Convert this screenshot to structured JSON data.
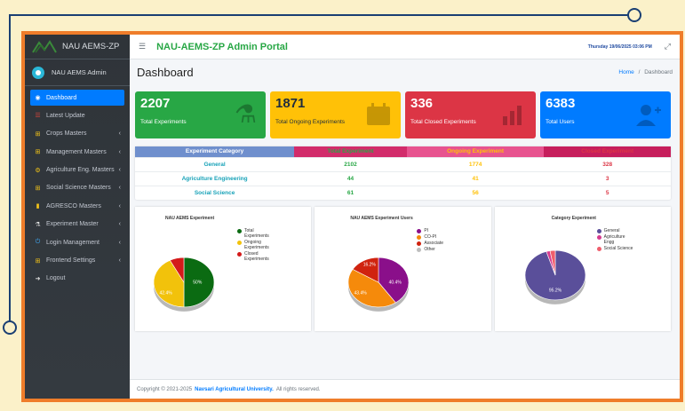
{
  "sidebar": {
    "brand": "NAU AEMS-ZP",
    "user_name": "NAU AEMS Admin",
    "items": [
      {
        "label": "Dashboard",
        "icon": "dashboard-icon",
        "chevron": false,
        "active": true
      },
      {
        "label": "Latest Update",
        "icon": "list-icon",
        "chevron": false,
        "active": false
      },
      {
        "label": "Crops Masters",
        "icon": "plus-square-icon",
        "chevron": true,
        "active": false
      },
      {
        "label": "Management Masters",
        "icon": "plus-square-icon",
        "chevron": true,
        "active": false
      },
      {
        "label": "Agriculture Eng. Masters",
        "icon": "cogs-icon",
        "chevron": true,
        "active": false
      },
      {
        "label": "Social Science Masters",
        "icon": "plus-square-icon",
        "chevron": true,
        "active": false
      },
      {
        "label": "AGRESCO Masters",
        "icon": "clipboard-icon",
        "chevron": true,
        "active": false
      },
      {
        "label": "Experiment Master",
        "icon": "flask-icon",
        "chevron": true,
        "active": false
      },
      {
        "label": "Login Management",
        "icon": "power-icon",
        "chevron": true,
        "active": false
      },
      {
        "label": "Frontend Settings",
        "icon": "plus-square-icon",
        "chevron": true,
        "active": false
      },
      {
        "label": "Logout",
        "icon": "logout-icon",
        "chevron": false,
        "active": false
      }
    ],
    "chevron_glyph": "‹"
  },
  "topbar": {
    "title": "NAU-AEMS-ZP Admin Portal",
    "datetime": "Thursday 19/06/2025 03:06 PM"
  },
  "header": {
    "page_title": "Dashboard",
    "breadcrumb_home": "Home",
    "breadcrumb_sep": "/",
    "breadcrumb_current": "Dashboard"
  },
  "stats": [
    {
      "value": "2207",
      "label": "Total Experiments",
      "color": "#28a745",
      "icon": "flask-icon"
    },
    {
      "value": "1871",
      "label": "Total Ongoing Experiments",
      "color": "#ffc107",
      "icon": "calendar-icon"
    },
    {
      "value": "336",
      "label": "Total Closed Experiments",
      "color": "#dc3545",
      "icon": "bar-chart-icon"
    },
    {
      "value": "6383",
      "label": "Total Users",
      "color": "#007bff",
      "icon": "user-plus-icon"
    }
  ],
  "table": {
    "headers": [
      "Experiment Category",
      "Total Experiment",
      "Ongoing Experiment",
      "Closed Experiment"
    ],
    "rows": [
      [
        "General",
        "2102",
        "1774",
        "328"
      ],
      [
        "Agriculture Engineering",
        "44",
        "41",
        "3"
      ],
      [
        "Social Science",
        "61",
        "56",
        "5"
      ]
    ]
  },
  "chart_data": [
    {
      "type": "pie",
      "title": "NAU AEMS Experiment",
      "categories": [
        "Total Experiments",
        "Ongoing Experiments",
        "Closed Experiments"
      ],
      "values": [
        50,
        42.4,
        7.6
      ],
      "colors": [
        "#0b6b12",
        "#f2c20b",
        "#d41a1a"
      ],
      "labels": [
        "50%",
        "42.4%",
        ""
      ]
    },
    {
      "type": "pie",
      "title": "NAU AEMS Experiment Users",
      "categories": [
        "PI",
        "CO-PI",
        "Associate",
        "Other"
      ],
      "values": [
        40.4,
        43.4,
        16.2,
        0
      ],
      "colors": [
        "#8a0f8a",
        "#f58a0b",
        "#d0230f",
        "#bdbdbd"
      ],
      "labels": [
        "40.4%",
        "43.4%",
        "16.2%",
        ""
      ]
    },
    {
      "type": "pie",
      "title": "Category Experiment",
      "categories": [
        "General",
        "Agriculture Engg",
        "Social Science"
      ],
      "values": [
        95.2,
        2.0,
        2.8
      ],
      "colors": [
        "#5a4f9a",
        "#d63c8f",
        "#ef5e6c"
      ],
      "labels": [
        "95.2%",
        "",
        ""
      ]
    }
  ],
  "footer": {
    "prefix": "Copyright © 2021-2025",
    "org": "Navsari Agricultural University.",
    "suffix": "All rights reserved."
  }
}
